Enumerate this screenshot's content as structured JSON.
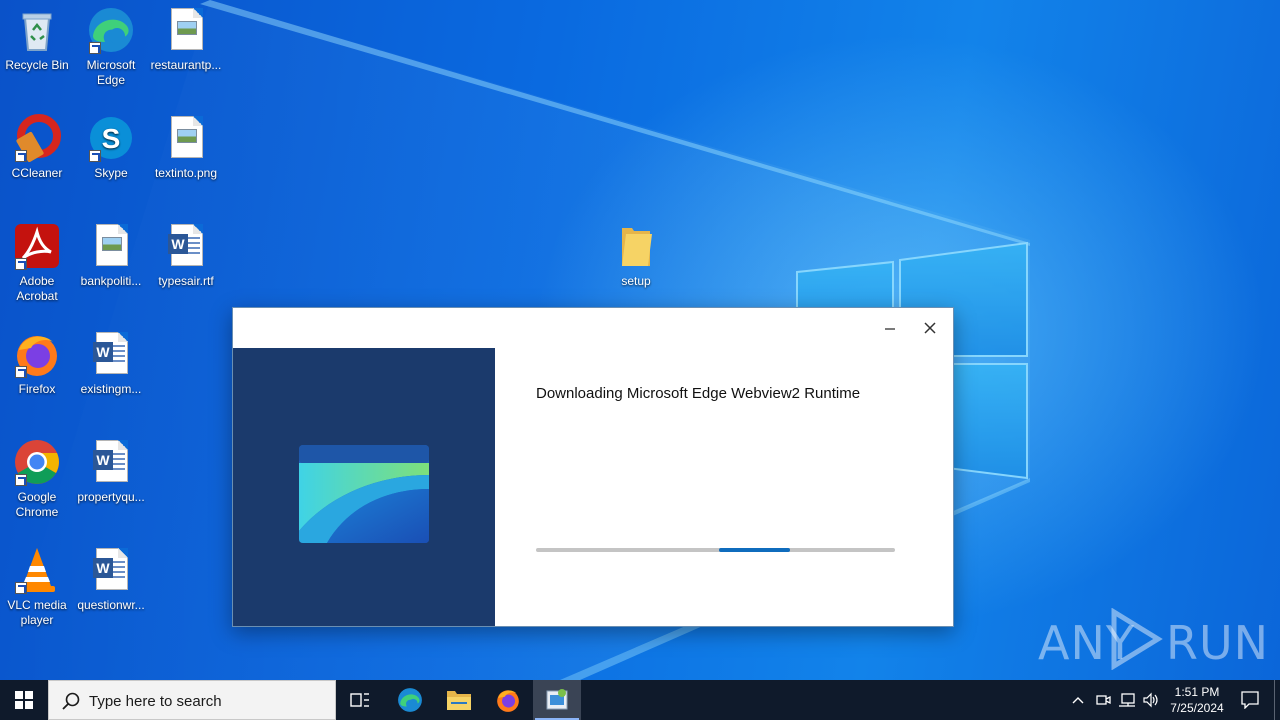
{
  "desktop": {
    "icons": [
      {
        "label": "Recycle Bin",
        "icon": "recycle-bin-icon"
      },
      {
        "label": "Microsoft Edge",
        "icon": "edge-icon"
      },
      {
        "label": "restaurantp...",
        "icon": "image-file-icon"
      },
      {
        "label": "CCleaner",
        "icon": "ccleaner-icon"
      },
      {
        "label": "Skype",
        "icon": "skype-icon"
      },
      {
        "label": "textinto.png",
        "icon": "image-file-icon"
      },
      {
        "label": "Adobe Acrobat",
        "icon": "acrobat-icon"
      },
      {
        "label": "bankpoliti...",
        "icon": "image-file-icon"
      },
      {
        "label": "typesair.rtf",
        "icon": "word-document-icon"
      },
      {
        "label": "Firefox",
        "icon": "firefox-icon"
      },
      {
        "label": "existingm...",
        "icon": "word-document-icon"
      },
      {
        "label": "Google Chrome",
        "icon": "chrome-icon"
      },
      {
        "label": "propertyqu...",
        "icon": "word-document-icon"
      },
      {
        "label": "VLC media player",
        "icon": "vlc-icon"
      },
      {
        "label": "questionwr...",
        "icon": "word-document-icon"
      },
      {
        "label": "setup",
        "icon": "folder-icon"
      }
    ]
  },
  "installer": {
    "status_text": "Downloading Microsoft Edge Webview2 Runtime",
    "progress": "indeterminate",
    "minimize_icon": "minimize-icon",
    "close_icon": "close-icon",
    "colors": {
      "panel": "#1b3a6c",
      "progress": "#0f6cbd",
      "track": "#c4c4c4"
    }
  },
  "watermark": {
    "left": "ANY",
    "right": "RUN"
  },
  "taskbar": {
    "search_placeholder": "Type here to search",
    "pinned": [
      "edge-icon",
      "file-explorer-icon",
      "firefox-icon",
      "installer-icon"
    ],
    "time": "1:51 PM",
    "date": "7/25/2024"
  }
}
